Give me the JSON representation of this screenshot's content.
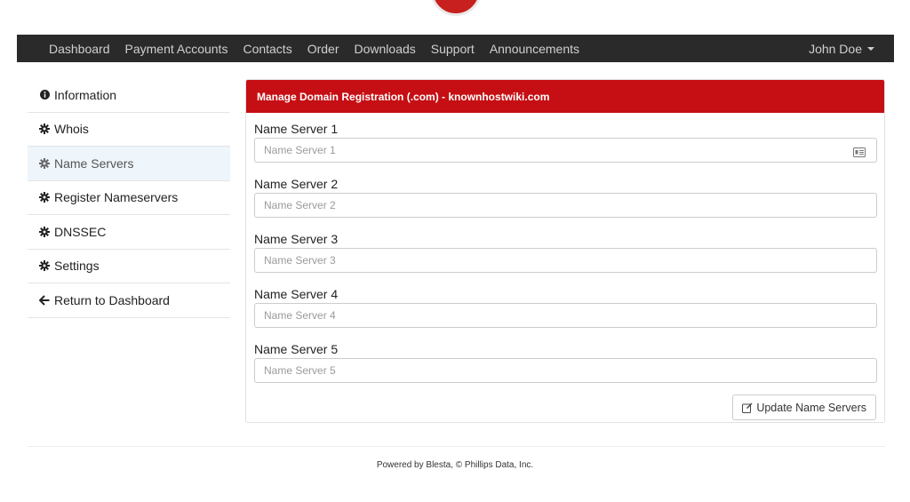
{
  "nav": {
    "items": [
      "Dashboard",
      "Payment Accounts",
      "Contacts",
      "Order",
      "Downloads",
      "Support",
      "Announcements"
    ],
    "user": "John Doe"
  },
  "sidebar": {
    "items": [
      {
        "label": "Information",
        "icon": "info-icon"
      },
      {
        "label": "Whois",
        "icon": "gear-icon"
      },
      {
        "label": "Name Servers",
        "icon": "gear-icon",
        "active": true
      },
      {
        "label": "Register Nameservers",
        "icon": "gear-icon"
      },
      {
        "label": "DNSSEC",
        "icon": "gear-icon"
      },
      {
        "label": "Settings",
        "icon": "gear-icon"
      },
      {
        "label": "Return to Dashboard",
        "icon": "arrow-left-icon"
      }
    ]
  },
  "panel": {
    "title": "Manage Domain Registration (.com) - knownhostwiki.com",
    "fields": [
      {
        "label": "Name Server 1",
        "placeholder": "Name Server 1",
        "value": ""
      },
      {
        "label": "Name Server 2",
        "placeholder": "Name Server 2",
        "value": ""
      },
      {
        "label": "Name Server 3",
        "placeholder": "Name Server 3",
        "value": ""
      },
      {
        "label": "Name Server 4",
        "placeholder": "Name Server 4",
        "value": ""
      },
      {
        "label": "Name Server 5",
        "placeholder": "Name Server 5",
        "value": ""
      }
    ],
    "submit_label": "Update Name Servers"
  },
  "footer": {
    "prefix": "Powered by ",
    "brand": "Blesta",
    "suffix": ", © Phillips Data, Inc."
  },
  "colors": {
    "navbar": "#2a2a2a",
    "accent": "#c50f14",
    "active_bg": "#eef5fb"
  }
}
